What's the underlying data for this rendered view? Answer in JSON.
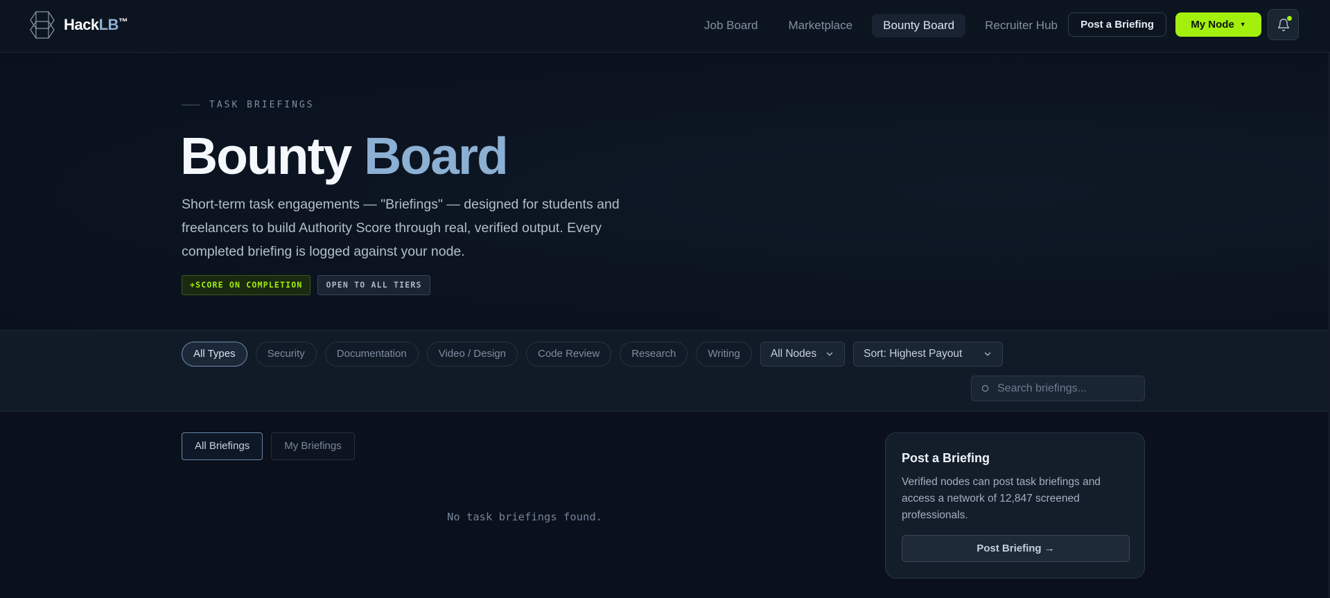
{
  "brand": {
    "name_main": "Hack",
    "name_accent": "LB",
    "trademark": "™"
  },
  "nav": {
    "links": [
      "Job Board",
      "Marketplace",
      "Bounty Board",
      "Recruiter Hub"
    ],
    "active_index": 2,
    "post_button": "Post a Briefing",
    "my_node_button": "My Node",
    "accent_color": "#a3ef0e"
  },
  "hero": {
    "kicker": "TASK BRIEFINGS",
    "title_word1": "Bounty",
    "title_word2": "Board",
    "description": "Short-term task engagements — \"Briefings\" — designed for students and freelancers to build Authority Score through real, verified output. Every completed briefing is logged against your node.",
    "tags": [
      "+SCORE ON COMPLETION",
      "OPEN TO ALL TIERS"
    ]
  },
  "filters": {
    "chips": [
      "All Types",
      "Security",
      "Documentation",
      "Video / Design",
      "Code Review",
      "Research",
      "Writing"
    ],
    "active_chip": 0,
    "node_select": "All Nodes",
    "sort_select": "Sort: Highest Payout",
    "search_placeholder": "Search briefings..."
  },
  "main": {
    "tabs": [
      "All Briefings",
      "My Briefings"
    ],
    "active_tab": 0,
    "empty_message": "No task briefings found."
  },
  "card": {
    "title": "Post a Briefing",
    "description": "Verified nodes can post task briefings and access a network of 12,847 screened professionals.",
    "button": "Post Briefing →"
  }
}
